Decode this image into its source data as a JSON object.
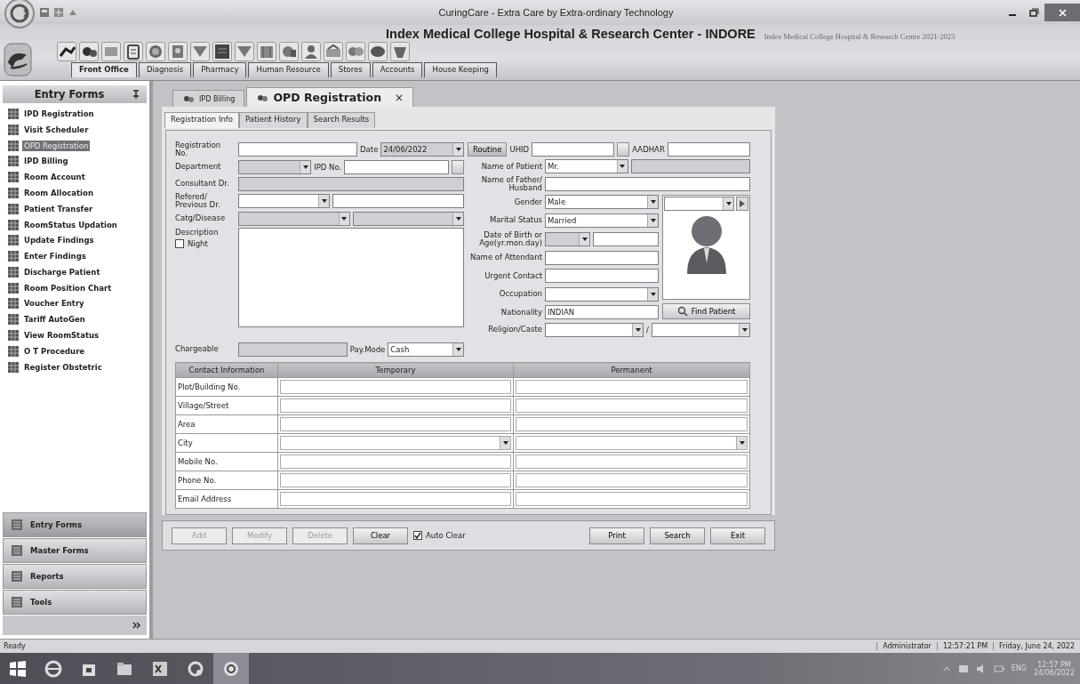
{
  "window": {
    "title": "CuringCare - Extra Care by Extra-ordinary Technology"
  },
  "header": {
    "hospital": "Index Medical College Hospital & Research Center - INDORE",
    "banner": "Index Medical College Hospital & Research Centre 2021-2023"
  },
  "ribbon_tabs": [
    {
      "label": "Front Office",
      "selected": true
    },
    {
      "label": "Diagnosis",
      "selected": false
    },
    {
      "label": "Pharmacy",
      "selected": false
    },
    {
      "label": "Human Resource",
      "selected": false
    },
    {
      "label": "Stores",
      "selected": false
    },
    {
      "label": "Accounts",
      "selected": false
    },
    {
      "label": "House Keeping",
      "selected": false
    }
  ],
  "sidebar": {
    "title": "Entry Forms",
    "items": [
      {
        "label": "IPD Registration",
        "selected": false
      },
      {
        "label": "Visit Scheduler",
        "selected": false
      },
      {
        "label": "OPD Registration",
        "selected": true
      },
      {
        "label": "IPD Billing",
        "selected": false
      },
      {
        "label": "Room Account",
        "selected": false
      },
      {
        "label": "Room Allocation",
        "selected": false
      },
      {
        "label": "Patient Transfer",
        "selected": false
      },
      {
        "label": "RoomStatus Updation",
        "selected": false
      },
      {
        "label": "Update Findings",
        "selected": false
      },
      {
        "label": "Enter Findings",
        "selected": false
      },
      {
        "label": "Discharge Patient",
        "selected": false
      },
      {
        "label": "Room Position Chart",
        "selected": false
      },
      {
        "label": "Voucher Entry",
        "selected": false
      },
      {
        "label": "Tariff AutoGen",
        "selected": false
      },
      {
        "label": "View RoomStatus",
        "selected": false
      },
      {
        "label": "O T Procedure",
        "selected": false
      },
      {
        "label": "Register Obstetric",
        "selected": false
      }
    ],
    "groups": [
      {
        "label": "Entry Forms",
        "selected": true
      },
      {
        "label": "Master Forms",
        "selected": false
      },
      {
        "label": "Reports",
        "selected": false
      },
      {
        "label": "Tools",
        "selected": false
      }
    ]
  },
  "doc_tabs": [
    {
      "label": "IPD Billing",
      "selected": false
    },
    {
      "label": "OPD Registration",
      "selected": true,
      "close": "×"
    }
  ],
  "sub_tabs": [
    {
      "label": "Registration Info",
      "selected": true
    },
    {
      "label": "Patient History",
      "selected": false
    },
    {
      "label": "Search Results",
      "selected": false
    }
  ],
  "form": {
    "left_rows": [
      {
        "label": "Registration No.",
        "items": [
          {
            "kind": "text",
            "disabled": false
          },
          {
            "kind": "label",
            "text": "Date"
          },
          {
            "kind": "combo",
            "value": "24/06/2022",
            "disabled": true
          }
        ]
      },
      {
        "label": "Department",
        "items": [
          {
            "kind": "combo",
            "disabled": true
          },
          {
            "kind": "label",
            "text": "IPD No."
          },
          {
            "kind": "text",
            "disabled": false
          },
          {
            "kind": "browse"
          }
        ]
      },
      {
        "label": "Consultant Dr.",
        "items": [
          {
            "kind": "text",
            "disabled": true
          }
        ]
      },
      {
        "label": "Refered/ Previous Dr.",
        "items": [
          {
            "kind": "combo",
            "disabled": false
          },
          {
            "kind": "text",
            "disabled": false
          }
        ]
      },
      {
        "label": "Catg/Disease",
        "items": [
          {
            "kind": "combo",
            "disabled": true
          },
          {
            "kind": "combo",
            "disabled": true
          }
        ]
      }
    ],
    "description": {
      "label": "Description",
      "night": {
        "label": "Night",
        "checked": false
      }
    },
    "charge_row": {
      "label": "Chargeable",
      "items": [
        {
          "kind": "text",
          "disabled": true
        },
        {
          "kind": "label",
          "text": "Pay.Mode"
        },
        {
          "kind": "combo",
          "value": "Cash",
          "disabled": false
        }
      ]
    },
    "right_top_rows": [
      {
        "items": [
          {
            "kind": "button",
            "text": "Routine"
          },
          {
            "kind": "label",
            "text": "UHID"
          },
          {
            "kind": "text",
            "disabled": false
          },
          {
            "kind": "browse"
          },
          {
            "kind": "label",
            "text": "AADHAR"
          },
          {
            "kind": "text",
            "disabled": false
          }
        ]
      },
      {
        "label": "Name of Patient",
        "items": [
          {
            "kind": "combo",
            "value": "Mr.",
            "disabled": false
          },
          {
            "kind": "text",
            "disabled": true
          }
        ]
      },
      {
        "label": "Name of Father/ Husband",
        "items": [
          {
            "kind": "text",
            "disabled": false
          }
        ]
      }
    ],
    "right_mid_rows": [
      {
        "label": "Gender",
        "items": [
          {
            "kind": "combo",
            "value": "Male",
            "disabled": false
          }
        ]
      },
      {
        "label": "Marital Status",
        "items": [
          {
            "kind": "combo",
            "value": "Married",
            "disabled": false
          }
        ]
      },
      {
        "label": "Date of Birth or Age(yr.mon.day)",
        "items": [
          {
            "kind": "combo",
            "disabled": true
          },
          {
            "kind": "text",
            "disabled": false
          }
        ]
      },
      {
        "label": "Name of Attendant",
        "items": [
          {
            "kind": "text",
            "disabled": false
          }
        ]
      },
      {
        "label": "Urgent Contact",
        "items": [
          {
            "kind": "text",
            "disabled": false
          }
        ]
      },
      {
        "label": "Occupation",
        "items": [
          {
            "kind": "combo",
            "disabled": false
          }
        ]
      },
      {
        "label": "Nationality",
        "items": [
          {
            "kind": "text",
            "value": "INDIAN",
            "disabled": false
          }
        ]
      }
    ],
    "photo_panel": {
      "find_button": "Find Patient"
    },
    "right_bottom_rows": [
      {
        "label": "Religion/Caste",
        "items": [
          {
            "kind": "combo",
            "disabled": false
          },
          {
            "kind": "label",
            "text": "/"
          },
          {
            "kind": "combo",
            "disabled": false
          }
        ]
      }
    ]
  },
  "contact_table": {
    "columns": [
      "Contact Information",
      "Temporary",
      "Permanent"
    ],
    "rows": [
      {
        "label": "Plot/Building No.",
        "kind": "text"
      },
      {
        "label": "Village/Street",
        "kind": "text"
      },
      {
        "label": "Area",
        "kind": "text"
      },
      {
        "label": "City",
        "kind": "combo"
      },
      {
        "label": "Mobile No.",
        "kind": "text"
      },
      {
        "label": "Phone No.",
        "kind": "text"
      },
      {
        "label": "Email Address",
        "kind": "text"
      }
    ]
  },
  "actions": [
    {
      "kind": "button",
      "label": "Add",
      "disabled": true
    },
    {
      "kind": "button",
      "label": "Modify",
      "disabled": true
    },
    {
      "kind": "button",
      "label": "Delete",
      "disabled": true
    },
    {
      "kind": "button",
      "label": "Clear",
      "disabled": false
    },
    {
      "kind": "checkbox",
      "label": "Auto Clear",
      "checked": true
    },
    {
      "kind": "spacer"
    },
    {
      "kind": "button",
      "label": "Print",
      "disabled": false
    },
    {
      "kind": "button",
      "label": "Search",
      "disabled": false
    },
    {
      "kind": "button",
      "label": "Exit",
      "disabled": false
    }
  ],
  "status_bar": {
    "left": "Ready",
    "user": "Administrator",
    "time": "12:57:21 PM",
    "date": "Friday, June 24, 2022"
  },
  "taskbar": {
    "language": "ENG",
    "time": "12:57 PM",
    "date": "24/06/2022"
  }
}
